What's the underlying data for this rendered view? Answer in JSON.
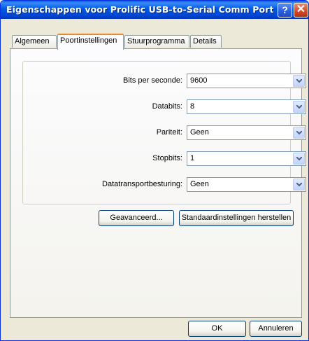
{
  "window": {
    "title": "Eigenschappen voor Prolific USB-to-Serial Comm Port (...",
    "help_symbol": "?",
    "close_symbol": "✕"
  },
  "tabs": [
    {
      "label": "Algemeen",
      "active": false
    },
    {
      "label": "Poortinstellingen",
      "active": true
    },
    {
      "label": "Stuurprogramma",
      "active": false
    },
    {
      "label": "Details",
      "active": false
    }
  ],
  "settings": {
    "bits_per_second": {
      "label": "Bits per seconde:",
      "value": "9600"
    },
    "data_bits": {
      "label": "Databits:",
      "value": "8"
    },
    "parity": {
      "label": "Pariteit:",
      "value": "Geen"
    },
    "stop_bits": {
      "label": "Stopbits:",
      "value": "1"
    },
    "flow_control": {
      "label": "Datatransportbesturing:",
      "value": "Geen"
    }
  },
  "buttons": {
    "advanced": "Geavanceerd...",
    "restore_defaults": "Standaardinstellingen herstellen",
    "ok": "OK",
    "cancel": "Annuleren"
  }
}
